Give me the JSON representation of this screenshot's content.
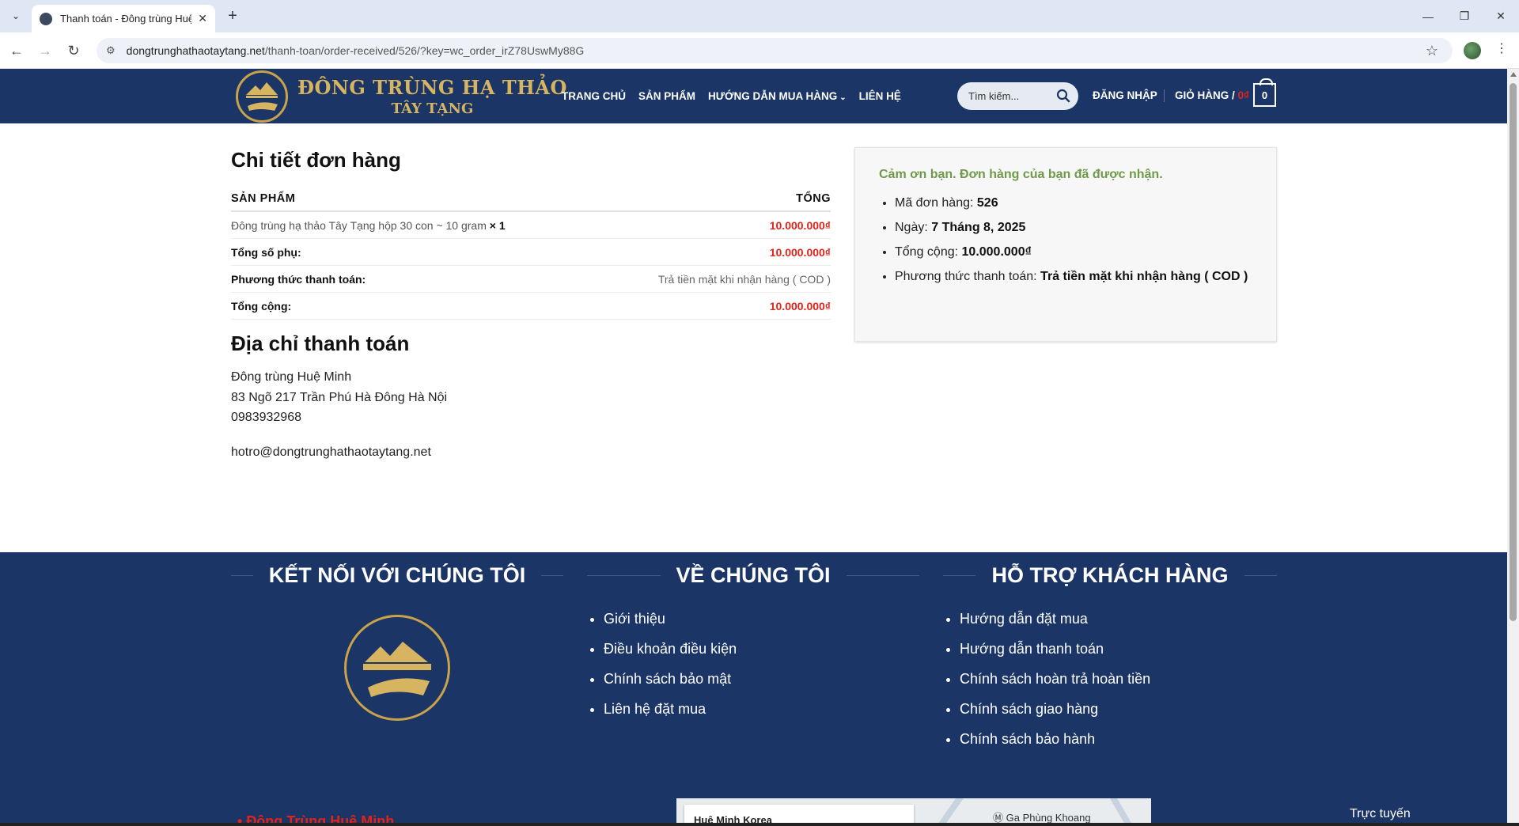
{
  "browser": {
    "tab_title": "Thanh toán - Đông trùng Huệ M",
    "url_domain": "dongtrunghathaotaytang.net",
    "url_path": "/thanh-toan/order-received/526/?key=wc_order_irZ78UswMy88G"
  },
  "header": {
    "logo_line1": "ĐÔNG TRÙNG HẠ THẢO",
    "logo_line2": "TÂY TẠNG",
    "nav": [
      "TRANG CHỦ",
      "SẢN PHẨM",
      "HƯỚNG DẪN MUA HÀNG",
      "LIÊN HỆ"
    ],
    "search_placeholder": "Tìm kiếm...",
    "login": "ĐĂNG NHẬP",
    "cart_label": "GIỎ HÀNG /",
    "cart_amount": "0₫",
    "cart_count": "0"
  },
  "order": {
    "title": "Chi tiết đơn hàng",
    "col_product": "SẢN PHẨM",
    "col_total": "TỔNG",
    "item_name": "Đông trùng hạ thảo Tây Tạng hộp 30 con ~ 10 gram",
    "item_qty": "× 1",
    "item_total": "10.000.000₫",
    "subtotal_label": "Tổng số phụ:",
    "subtotal_value": "10.000.000₫",
    "payment_label": "Phương thức thanh toán:",
    "payment_value": "Trả tiền mặt khi nhận hàng ( COD )",
    "total_label": "Tổng cộng:",
    "total_value": "10.000.000₫"
  },
  "billing": {
    "title": "Địa chỉ thanh toán",
    "name": "Đông trùng Huệ Minh",
    "address": "83 Ngõ 217 Trần Phú Hà Đông Hà Nội",
    "phone": "0983932968",
    "email": "hotro@dongtrunghathaotaytang.net"
  },
  "thanks": {
    "message": "Cảm ơn bạn. Đơn hàng của bạn đã được nhận.",
    "order_no_label": "Mã đơn hàng:",
    "order_no": "526",
    "date_label": "Ngày:",
    "date": "7 Tháng 8, 2025",
    "total_label": "Tổng cộng:",
    "total": "10.000.000₫",
    "payment_label": "Phương thức thanh toán:",
    "payment": "Trả tiền mặt khi nhận hàng ( COD )"
  },
  "footer": {
    "col1_title": "KẾT NỐI VỚI CHÚNG TÔI",
    "col2_title": "VỀ CHÚNG TÔI",
    "col3_title": "HỖ TRỢ KHÁCH HÀNG",
    "about_links": [
      "Giới thiệu",
      "Điều khoản điều kiện",
      "Chính sách bảo mật",
      "Liên hệ đặt mua"
    ],
    "support_links": [
      "Hướng dẫn đặt mua",
      "Hướng dẫn thanh toán",
      "Chính sách hoàn trả hoàn tiền",
      "Chính sách giao hàng",
      "Chính sách bảo hành"
    ],
    "red_link": "Đông Trùng Huệ Minh",
    "map_place": "Huệ Minh Korea",
    "map_label": "Ga Phùng Khoang",
    "online": "Trực tuyến"
  },
  "colors": {
    "brand_navy": "#1b3567",
    "gold": "#d7b560",
    "price_red": "#e2231a",
    "thanks_green": "#6f9a4a"
  }
}
